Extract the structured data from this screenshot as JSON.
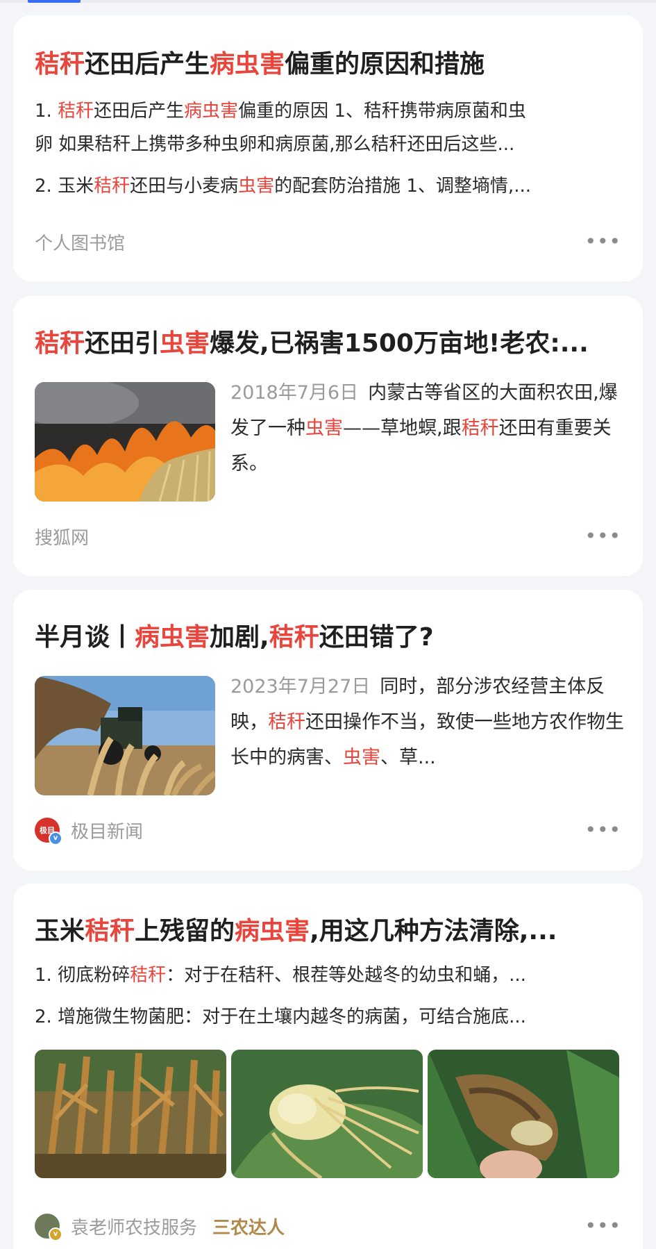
{
  "cards": [
    {
      "title_segments": [
        "秸秆",
        "还田后产生",
        "病虫害",
        "偏重的原因和措施"
      ],
      "lines": [
        [
          "1. ",
          "秸秆",
          "还田后产生",
          "病虫害",
          "偏重的原因 1、秸秆携带病原菌和虫"
        ],
        [
          "卵 如果秸秆上携带多种虫卵和病原菌,那么秸秆还田后这些..."
        ],
        [
          "2. 玉米",
          "秸秆",
          "还田与小麦病",
          "虫害",
          "的配套防治措施 1、调整墒情,..."
        ]
      ],
      "source": "个人图书馆"
    },
    {
      "title_segments": [
        "秸秆",
        "还田引",
        "虫害",
        "爆发,已祸害1500万亩地!老农:..."
      ],
      "date": "2018年7月6日",
      "body_segments": [
        "内蒙古等省区的大面积农田,爆发了一种",
        "虫害",
        "——草地螟,跟",
        "秸秆",
        "还田有重要关系。"
      ],
      "source": "搜狐网"
    },
    {
      "title_segments": [
        "半月谈丨",
        "病虫害",
        "加剧,",
        "秸秆",
        "还田错了?"
      ],
      "date": "2023年7月27日",
      "body_segments": [
        "同时，部分涉农经营主体反映，",
        "秸秆",
        "还田操作不当，致使一些地方农作物生长中的病害、",
        "虫害",
        "、草..."
      ],
      "source": "极目新闻",
      "avatar_text": "极目"
    },
    {
      "title_segments": [
        "玉米",
        "秸秆",
        "上残留的",
        "病虫害",
        ",用这几种方法清除,..."
      ],
      "lines": [
        [
          "1. 彻底粉碎",
          "秸秆",
          "：对于在秸秆、根茬等处越冬的幼虫和蛹，..."
        ],
        [
          "2. 增施微生物菌肥：对于在土壤内越冬的病菌，可结合施底..."
        ]
      ],
      "source": "袁老师农技服务",
      "tag": "三农达人"
    }
  ],
  "more_label": "•••",
  "verified_mark": "v",
  "colors": {
    "highlight": "#e8453c",
    "tag": "#b0894a",
    "accent_tab": "#3a6cf0"
  }
}
